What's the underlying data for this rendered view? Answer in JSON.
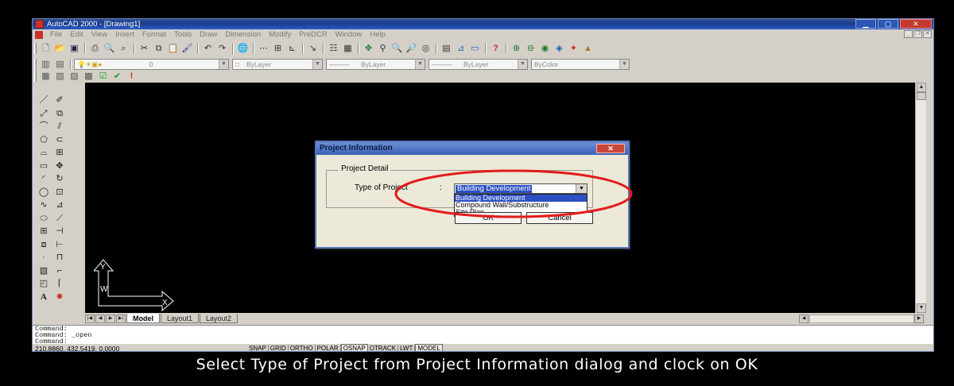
{
  "window": {
    "title": "AutoCAD 2000 - [Drawing1]"
  },
  "menu": [
    "File",
    "Edit",
    "View",
    "Insert",
    "Format",
    "Tools",
    "Draw",
    "Dimension",
    "Modify",
    "PreDCR",
    "Window",
    "Help"
  ],
  "standard_toolbar": {
    "icons": [
      "new-icon",
      "open-icon",
      "save-icon",
      "print-icon",
      "print-preview-icon",
      "find-icon",
      "cut-icon",
      "copy-icon",
      "paste-icon",
      "match-properties-icon",
      "undo-icon",
      "redo-icon",
      "hyperlink-icon",
      "snap-from-icon",
      "object-snap-icon",
      "ucs-icon",
      "distance-icon",
      "properties-icon",
      "design-center-icon",
      "pan-icon",
      "zoom-realtime-icon",
      "zoom-window-icon",
      "zoom-previous-icon",
      "aerial-view-icon",
      "layer-properties-icon",
      "tool-palette-icon",
      "redraw-icon",
      "help-icon"
    ]
  },
  "properties_toolbar": {
    "layer_value": "0",
    "color_value": "ByLayer",
    "linetype_value": "ByLayer",
    "lineweight_value": "ByLayer",
    "plotstyle_value": "ByColor"
  },
  "tabs": {
    "model": "Model",
    "layout1": "Layout1",
    "layout2": "Layout2"
  },
  "command_history": [
    "Command:",
    "Command: _open",
    "Command:"
  ],
  "status": {
    "coordinates": "210.8860, 432.5419, 0.0000",
    "toggles": [
      "SNAP",
      "GRID",
      "ORTHO",
      "POLAR",
      "OSNAP",
      "OTRACK",
      "LWT",
      "MODEL"
    ],
    "toggles_on": [
      "OSNAP",
      "MODEL"
    ]
  },
  "dialog": {
    "title": "Project Information",
    "close_label": "✕",
    "group_label": "Project Detail",
    "type_label": "Type of Project",
    "colon": ":",
    "selected_value": "Building Development",
    "options": [
      "Building Development",
      "Compound Wall/Substructure",
      "Site Plan"
    ],
    "ok_label": "OK",
    "cancel_label": "Cancel"
  },
  "ucs_labels": {
    "y": "Y",
    "x": "X",
    "w": "W"
  },
  "caption": "Select Type of Project from Project Information dialog and clock on OK",
  "colors": {
    "title_bar": "#1b3d8c",
    "canvas": "#000000",
    "highlight": "#2c4fc4",
    "annotation": "#e21b1b"
  }
}
